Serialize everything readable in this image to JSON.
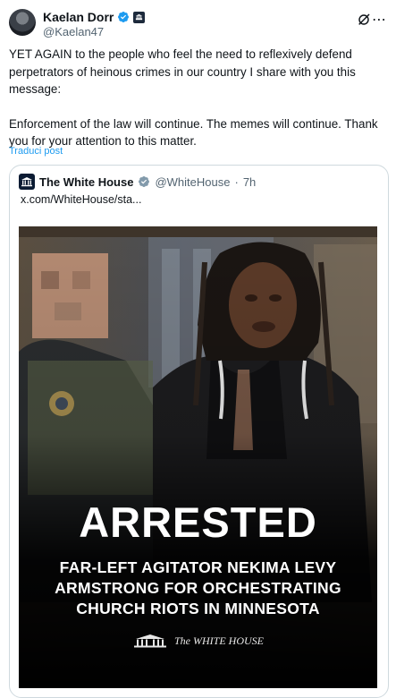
{
  "post": {
    "author": {
      "name": "Kaelan Dorr",
      "handle": "@Kaelan47"
    },
    "paragraphs": [
      "YET AGAIN to the people who feel the need to reflexively defend perpetrators of heinous crimes in our country I share with you this message:",
      "Enforcement of the law will continue. The memes will continue. Thank you for your attention to this matter."
    ],
    "translate_label": "Traduci post",
    "icons": [
      "avatar",
      "verified-badge-icon",
      "affiliation-badge-icon",
      "grok-icon",
      "more-options-icon"
    ]
  },
  "quote": {
    "name": "The White House",
    "handle": "@WhiteHouse",
    "separator": "·",
    "time": "7h",
    "link": "x.com/WhiteHouse/sta...",
    "image": {
      "big_title": "ARRESTED",
      "lines": [
        "FAR-LEFT AGITATOR NEKIMA LEVY",
        "ARMSTRONG FOR ORCHESTRATING",
        "CHURCH RIOTS IN MINNESOTA"
      ],
      "footer": "The WHITE HOUSE"
    }
  },
  "colors": {
    "link": "#1d9bf0",
    "muted": "#536471",
    "border": "#cfd9de",
    "verified": "#1d9bf0"
  }
}
